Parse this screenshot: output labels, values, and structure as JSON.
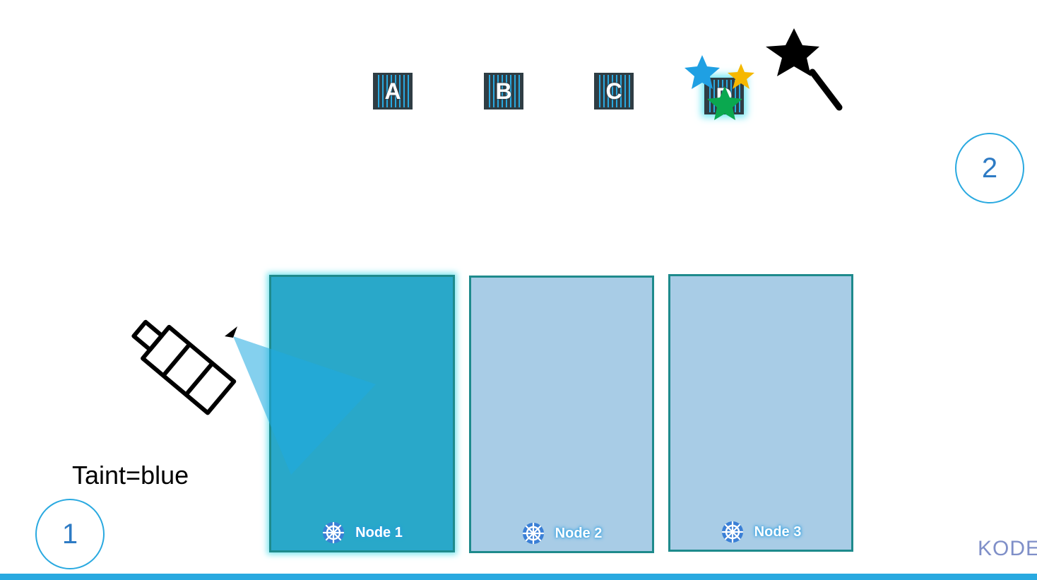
{
  "pods": [
    {
      "label": "A"
    },
    {
      "label": "B"
    },
    {
      "label": "C"
    },
    {
      "label": "D"
    }
  ],
  "nodes": [
    {
      "label": "Node 1",
      "fill": "#29a8c9",
      "highlighted": true
    },
    {
      "label": "Node 2",
      "fill": "#a8cce6",
      "highlighted": false
    },
    {
      "label": "Node 3",
      "fill": "#a8cce6",
      "highlighted": false
    }
  ],
  "taint_label": "Taint=blue",
  "step_markers": [
    "1",
    "2"
  ],
  "logo_text": "KODE",
  "icons": [
    "spray-bottle-icon",
    "magic-wand-icon",
    "star-icon",
    "kubernetes-helm-icon"
  ],
  "colors": {
    "accent": "#29a9e0",
    "spray": "#1fa9e0",
    "star_blue": "#1fa0e3",
    "star_yellow": "#f5b800",
    "star_green": "#0aa84f"
  }
}
